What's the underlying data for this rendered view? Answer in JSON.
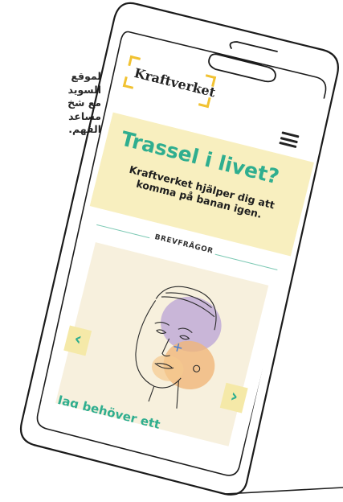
{
  "side_text": {
    "lines": [
      "لموقع",
      "السويد",
      "مع شخ",
      "مساعد",
      "الفهم."
    ]
  },
  "phone": {
    "brand": "Kraftverket",
    "menu_icon": "hamburger-menu-icon",
    "hero": {
      "title": "Trassel i livet?",
      "subtitle": "Kraftverket hjälper dig att komma på banan igen."
    },
    "section_label": "BREVFRÅGOR",
    "card": {
      "caption": "Jag behöver ett",
      "prev_icon": "chevron-left-icon",
      "next_icon": "chevron-right-icon",
      "prev_glyph": "‹",
      "next_glyph": "›"
    }
  },
  "colors": {
    "accent_green": "#2fae8f",
    "hero_bg": "#f8efbf",
    "logo_yellow": "#f1c232",
    "card_bg": "#f7f0dd"
  }
}
